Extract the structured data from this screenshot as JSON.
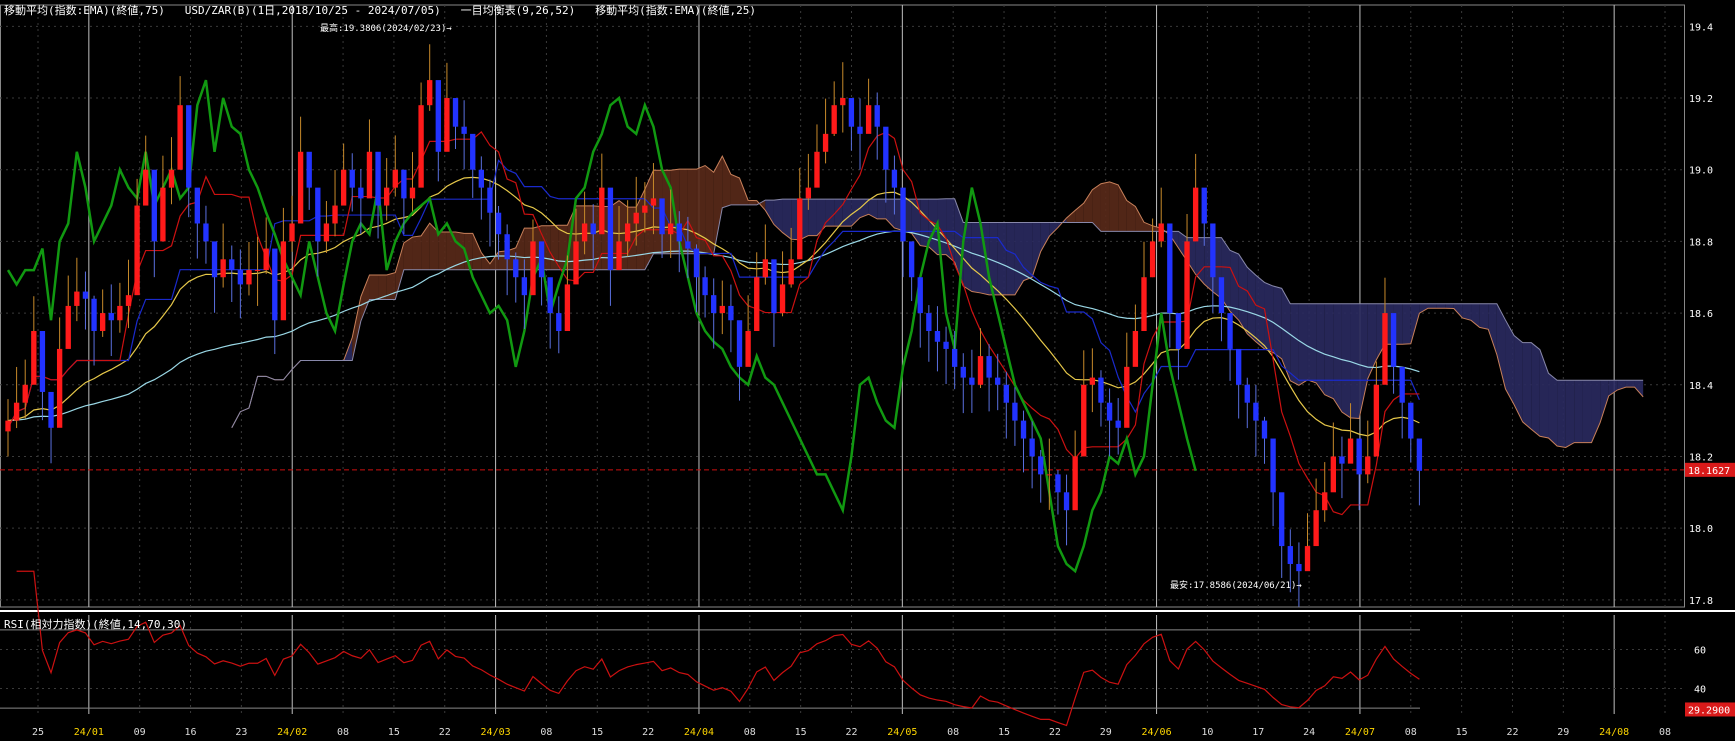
{
  "header": {
    "main_title": "移動平均(指数:EMA)(終値,75)   USD/ZAR(B)(1日,2018/10/25 - 2024/07/05)   一目均衡表(9,26,52)   移動平均(指数:EMA)(終値,25)",
    "rsi_title": "RSI(相対力指数)(終値,14,70,30)"
  },
  "annotations": {
    "high": "最高:19.3806(2024/02/23)→",
    "low": "最安:17.8586(2024/06/21)→"
  },
  "colors": {
    "background": "#000000",
    "grid": "#3a3a3a",
    "month_line": "#bfbfbf",
    "up_candle": "#ff1a1a",
    "down_candle": "#2233ff",
    "chikou": "#119911",
    "tenkan": "#cc1111",
    "kijun": "#1a2acc",
    "ema25": "#e6c84a",
    "ema75": "#9ad8e6",
    "kumo_bull": "#5a2a1a",
    "kumo_bear": "#2a2a60",
    "price_tag": "#d91a1a",
    "rsi_line": "#cc1111"
  },
  "chart_data": [
    {
      "type": "candlestick",
      "title": "USD/ZAR(B)(1日,2018/10/25 - 2024/07/05)",
      "y_ticks": [
        "17.8",
        "18.0",
        "18.2",
        "18.4",
        "18.6",
        "18.8",
        "19.0",
        "19.2",
        "19.4"
      ],
      "ylim": [
        17.78,
        19.44
      ],
      "x_tick_labels": [
        "25",
        "24/01",
        "09",
        "16",
        "23",
        "24/02",
        "08",
        "15",
        "22",
        "24/03",
        "08",
        "15",
        "22",
        "24/04",
        "08",
        "15",
        "22",
        "24/05",
        "08",
        "15",
        "22",
        "29",
        "24/06",
        "10",
        "17",
        "24",
        "24/07",
        "08",
        "15",
        "22",
        "29",
        "24/08",
        "08"
      ],
      "month_labels": [
        "24/01",
        "24/02",
        "24/03",
        "24/04",
        "24/05",
        "24/06",
        "24/07",
        "24/08"
      ],
      "current_price": 18.1627,
      "current_price_label": "18.1627",
      "high": {
        "value": 19.3806,
        "date": "2024/02/23"
      },
      "low": {
        "value": 17.8586,
        "date": "2024/06/21"
      },
      "closes": [
        18.3,
        18.35,
        18.4,
        18.55,
        18.38,
        18.28,
        18.5,
        18.62,
        18.66,
        18.64,
        18.55,
        18.6,
        18.58,
        18.62,
        18.65,
        18.9,
        19.0,
        18.8,
        18.95,
        19.0,
        19.18,
        18.95,
        18.85,
        18.8,
        18.7,
        18.75,
        18.72,
        18.68,
        18.72,
        18.72,
        18.78,
        18.58,
        18.8,
        18.85,
        19.05,
        18.95,
        18.8,
        18.85,
        18.9,
        19.0,
        18.95,
        18.92,
        19.05,
        18.9,
        18.95,
        19.0,
        18.92,
        18.95,
        19.18,
        19.25,
        19.05,
        19.2,
        19.12,
        19.1,
        19.0,
        18.95,
        18.88,
        18.82,
        18.75,
        18.7,
        18.65,
        18.8,
        18.7,
        18.6,
        18.55,
        18.68,
        18.8,
        18.85,
        18.82,
        18.95,
        18.72,
        18.8,
        18.85,
        18.88,
        18.9,
        18.92,
        18.82,
        18.85,
        18.8,
        18.78,
        18.7,
        18.65,
        18.6,
        18.62,
        18.58,
        18.45,
        18.55,
        18.7,
        18.75,
        18.6,
        18.68,
        18.75,
        18.92,
        18.95,
        19.05,
        19.1,
        19.18,
        19.2,
        19.12,
        19.1,
        19.18,
        19.12,
        19.0,
        18.95,
        18.8,
        18.7,
        18.6,
        18.55,
        18.52,
        18.5,
        18.45,
        18.42,
        18.4,
        18.48,
        18.42,
        18.4,
        18.35,
        18.3,
        18.25,
        18.2,
        18.15,
        18.15,
        18.1,
        18.05,
        18.2,
        18.4,
        18.42,
        18.35,
        18.3,
        18.28,
        18.45,
        18.55,
        18.7,
        18.8,
        18.85,
        18.6,
        18.5,
        18.8,
        18.95,
        18.85,
        18.7,
        18.6,
        18.5,
        18.4,
        18.35,
        18.3,
        18.25,
        18.1,
        17.95,
        17.9,
        17.88,
        17.95,
        18.05,
        18.1,
        18.2,
        18.18,
        18.25,
        18.15,
        18.2,
        18.4,
        18.6,
        18.45,
        18.35,
        18.25,
        18.16
      ]
    },
    {
      "type": "line",
      "title": "RSI(相対力指数)(終値,14,70,30)",
      "y_ticks": [
        "40",
        "60"
      ],
      "ylim": [
        28,
        72
      ],
      "current_value": 29.29,
      "current_value_label": "29.2900"
    }
  ]
}
